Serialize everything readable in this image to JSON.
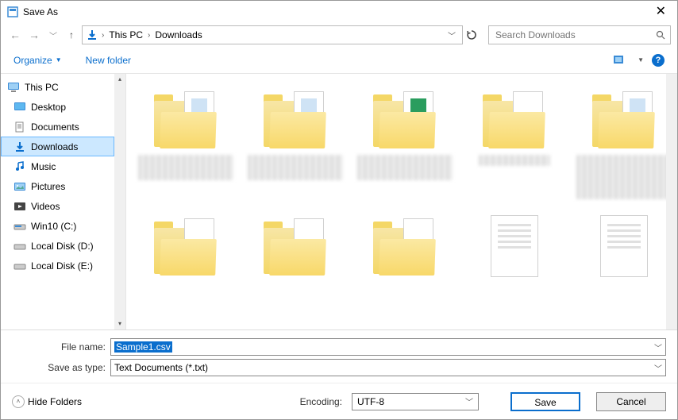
{
  "titlebar": {
    "title": "Save As"
  },
  "nav": {
    "breadcrumb": {
      "root": "This PC",
      "current": "Downloads"
    },
    "search_placeholder": "Search Downloads"
  },
  "toolbar": {
    "organize": "Organize",
    "newfolder": "New folder"
  },
  "sidebar": {
    "items": [
      {
        "label": "This PC",
        "icon": "pc"
      },
      {
        "label": "Desktop",
        "icon": "desktop"
      },
      {
        "label": "Documents",
        "icon": "documents"
      },
      {
        "label": "Downloads",
        "icon": "downloads",
        "selected": true
      },
      {
        "label": "Music",
        "icon": "music"
      },
      {
        "label": "Pictures",
        "icon": "pictures"
      },
      {
        "label": "Videos",
        "icon": "videos"
      },
      {
        "label": "Win10 (C:)",
        "icon": "drive"
      },
      {
        "label": "Local Disk (D:)",
        "icon": "drive"
      },
      {
        "label": "Local Disk (E:)",
        "icon": "drive"
      }
    ]
  },
  "form": {
    "filename_label": "File name:",
    "filename_value": "Sample1.csv",
    "saveastype_label": "Save as type:",
    "saveastype_value": "Text Documents (*.txt)"
  },
  "footer": {
    "hide_folders": "Hide Folders",
    "encoding_label": "Encoding:",
    "encoding_value": "UTF-8",
    "save": "Save",
    "cancel": "Cancel"
  }
}
